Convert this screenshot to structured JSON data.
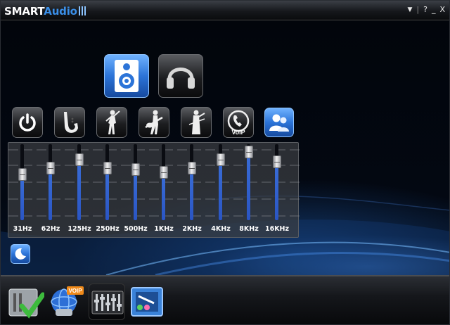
{
  "app": {
    "logo_part1": "SMART",
    "logo_part2": "Audio",
    "brand_white": "#ffffff",
    "brand_blue": "#3a8fe8"
  },
  "window_controls": {
    "menu_icon": "▼",
    "sep": "|",
    "help": "?",
    "minimize": "_",
    "close": "X"
  },
  "output_devices": [
    {
      "name": "speaker-icon",
      "selected": true
    },
    {
      "name": "headphone-icon",
      "selected": false
    }
  ],
  "presets": [
    {
      "name": "power-icon",
      "selected": false
    },
    {
      "name": "saxophone-icon",
      "selected": false
    },
    {
      "name": "dancer-icon",
      "selected": false
    },
    {
      "name": "guitarist-icon",
      "selected": false
    },
    {
      "name": "violinist-icon",
      "selected": false
    },
    {
      "name": "voip-icon",
      "label": "VoIP",
      "selected": false
    },
    {
      "name": "users-icon",
      "selected": true
    }
  ],
  "equalizer": {
    "bands": [
      {
        "label": "31Hz",
        "level": 0.62
      },
      {
        "label": "62Hz",
        "level": 0.72
      },
      {
        "label": "125Hz",
        "level": 0.86
      },
      {
        "label": "250Hz",
        "level": 0.72
      },
      {
        "label": "500Hz",
        "level": 0.7
      },
      {
        "label": "1KHz",
        "level": 0.66
      },
      {
        "label": "2KHz",
        "level": 0.72
      },
      {
        "label": "4KHz",
        "level": 0.86
      },
      {
        "label": "8KHz",
        "level": 0.98
      },
      {
        "label": "16KHz",
        "level": 0.82
      }
    ],
    "fill_color": "#2a55c4"
  },
  "night_mode": {
    "icon": "moon-icon"
  },
  "bottom_tabs": [
    {
      "name": "checklist-icon",
      "selected": false
    },
    {
      "name": "voip-globe-icon",
      "label": "VOIP",
      "selected": false
    },
    {
      "name": "equalizer-icon",
      "selected": true
    },
    {
      "name": "jack-config-icon",
      "selected": false
    }
  ]
}
